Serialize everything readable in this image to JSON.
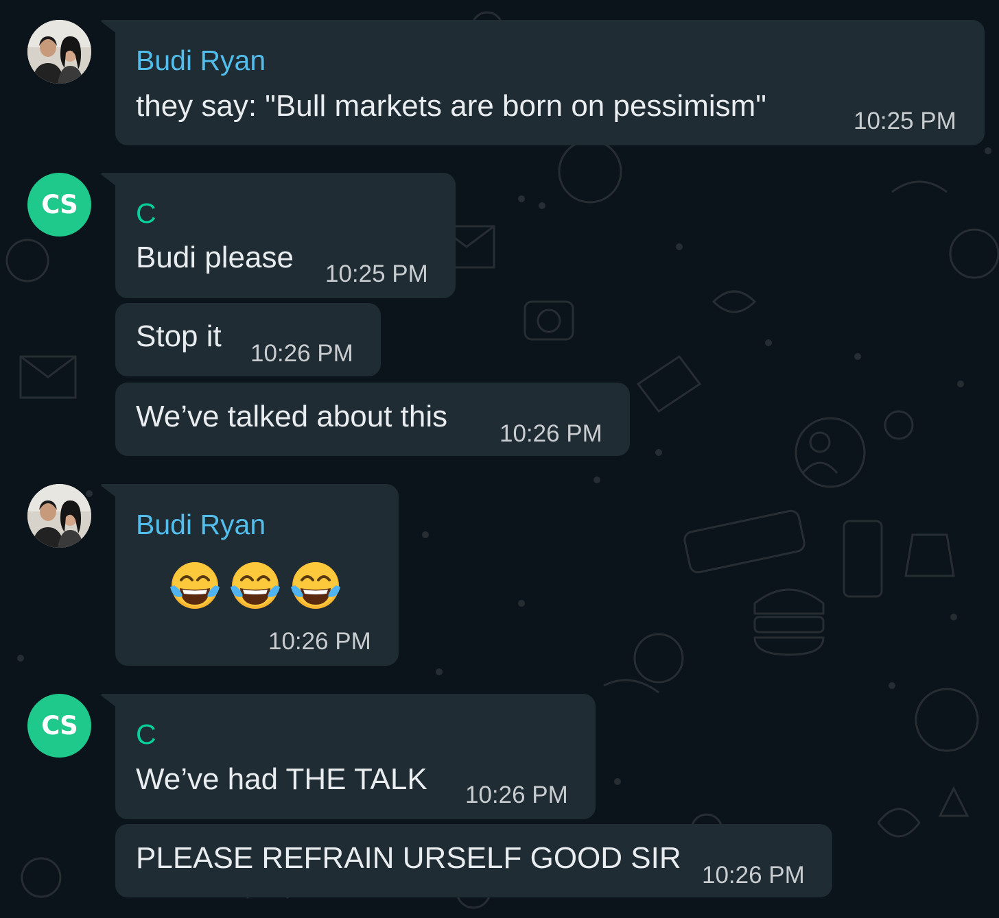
{
  "messages": [
    {
      "sender": "Budi Ryan",
      "avatar": "photo",
      "text": "they say: \"Bull markets are born on pessimism\"",
      "time": "10:25 PM"
    },
    {
      "sender": "C",
      "avatar_initials": "CS",
      "text": "Budi please",
      "time": "10:25 PM"
    },
    {
      "text": "Stop it",
      "time": "10:26 PM"
    },
    {
      "text": "We’ve talked about this",
      "time": "10:26 PM"
    },
    {
      "sender": "Budi Ryan",
      "avatar": "photo",
      "emojis": [
        "face-with-tears-of-joy",
        "face-with-tears-of-joy",
        "face-with-tears-of-joy"
      ],
      "time": "10:26 PM"
    },
    {
      "sender": "C",
      "avatar_initials": "CS",
      "text": "We’ve had THE TALK",
      "time": "10:26 PM"
    },
    {
      "text": "PLEASE REFRAIN URSELF GOOD SIR",
      "time": "10:26 PM"
    }
  ],
  "colors": {
    "background": "#0b141a",
    "bubble": "#1f2c34",
    "sender_budi": "#53bdeb",
    "sender_c": "#06cf9c",
    "avatar_cs": "#1ec98b",
    "message_text": "#e9edef",
    "timestamp": "#c9cdd0"
  }
}
